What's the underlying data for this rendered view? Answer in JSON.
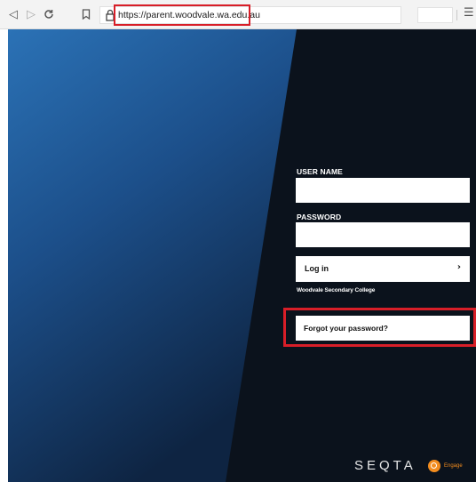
{
  "browser": {
    "url": "https://parent.woodvale.wa.edu.au",
    "back_icon": "back-icon",
    "forward_icon": "forward-icon",
    "reload_icon": "reload-icon",
    "bookmark_icon": "bookmark-icon",
    "lock_icon": "lock-icon",
    "menu_icon": "menu-icon"
  },
  "login": {
    "username_label": "USER NAME",
    "username_value": "",
    "password_label": "PASSWORD",
    "password_value": "",
    "login_button": "Log in",
    "chevron": "›",
    "school": "Woodvale Secondary College",
    "forgot_button": "Forgot your password?"
  },
  "footer": {
    "brand": "SEQTA",
    "engage": "Engage"
  },
  "colors": {
    "highlight": "#d81e28",
    "panel_dark": "#0b121c",
    "blue_light": "#2a6db0",
    "blue_dark": "#0f2a4a",
    "engage_orange": "#f28c1e"
  }
}
